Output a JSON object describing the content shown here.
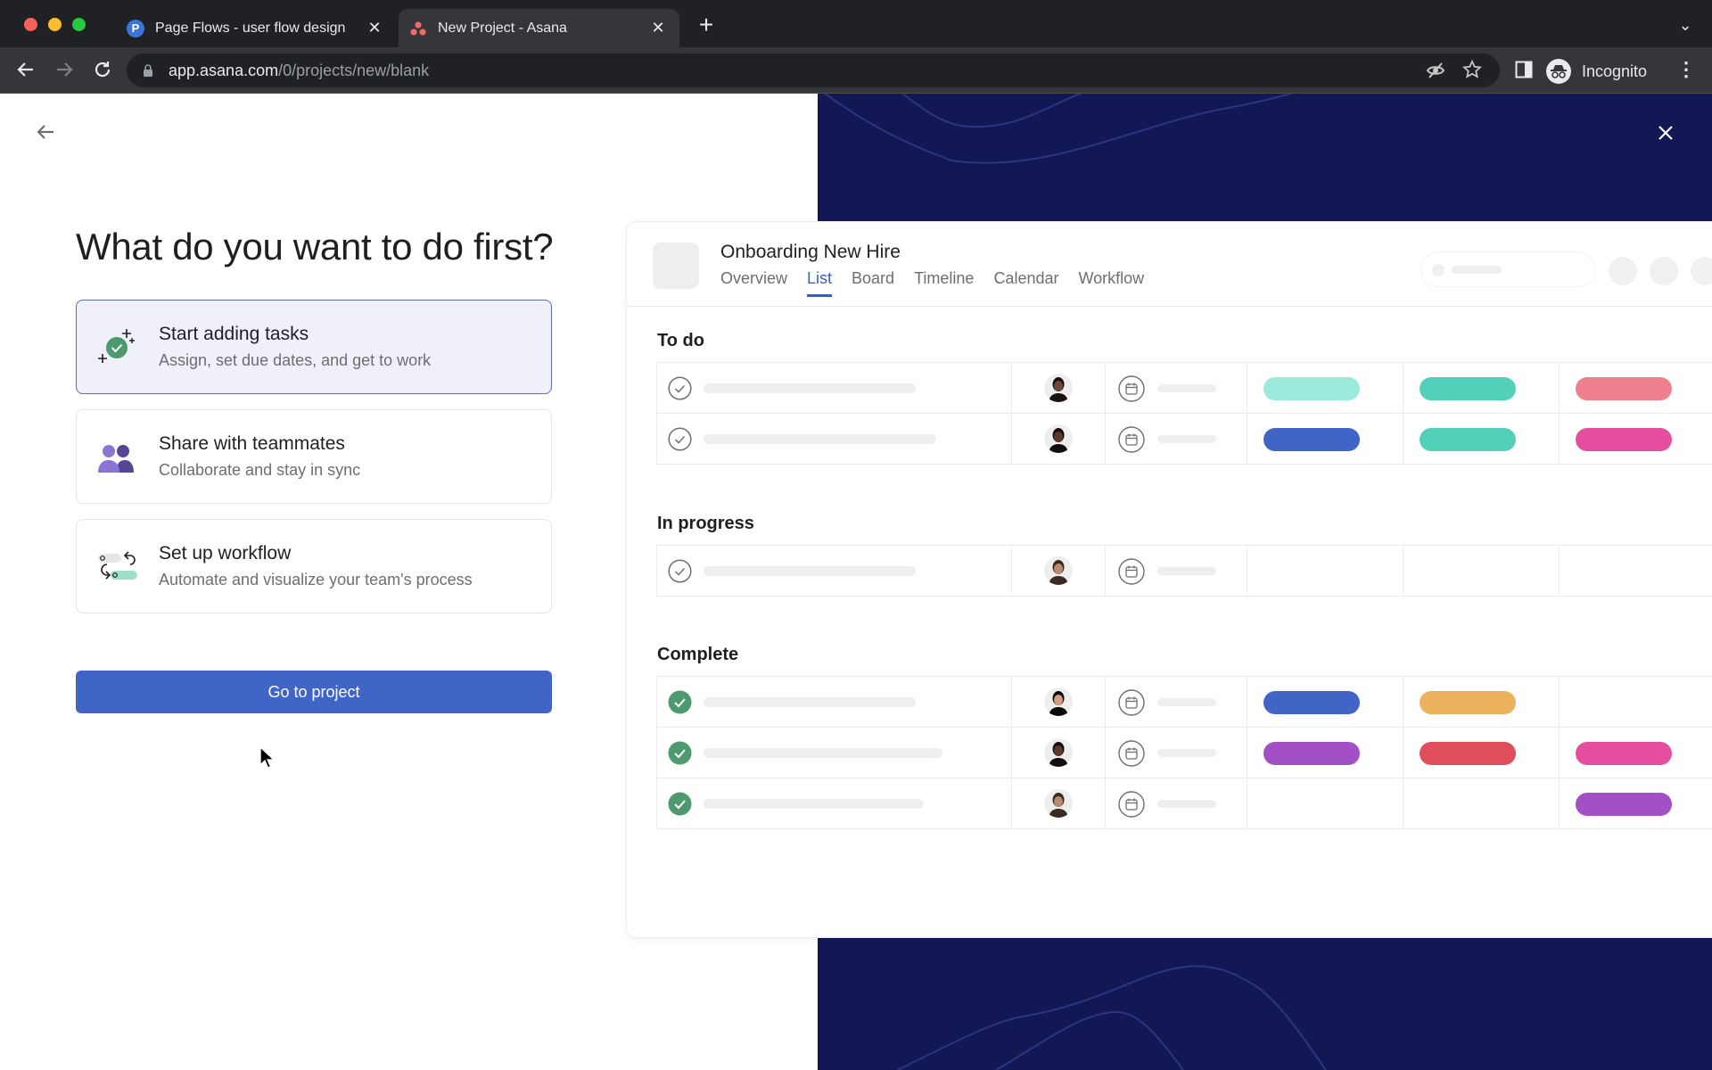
{
  "browser": {
    "tabs": [
      {
        "title": "Page Flows - user flow design",
        "favicon": "P",
        "favicon_color": "#3b73d6",
        "active": false
      },
      {
        "title": "New Project - Asana",
        "favicon": "asana-logo",
        "favicon_color": "#f06a6a",
        "active": true
      }
    ],
    "url_host": "app.asana.com",
    "url_path": "/0/projects/new/blank",
    "profile_label": "Incognito"
  },
  "page": {
    "heading": "What do you want to do first?",
    "options": [
      {
        "title": "Start adding tasks",
        "description": "Assign, set due dates, and get to work",
        "icon": "sparkle-check-icon",
        "selected": true
      },
      {
        "title": "Share with teammates",
        "description": "Collaborate and stay in sync",
        "icon": "people-icon",
        "selected": false
      },
      {
        "title": "Set up workflow",
        "description": "Automate and visualize your team's process",
        "icon": "workflow-icon",
        "selected": false
      }
    ],
    "primary_button": "Go to project",
    "accent_color": "#4065c6",
    "panel_color": "#131754"
  },
  "preview": {
    "project_title": "Onboarding New Hire",
    "tabs": [
      {
        "label": "Overview",
        "active": false
      },
      {
        "label": "List",
        "active": true
      },
      {
        "label": "Board",
        "active": false
      },
      {
        "label": "Timeline",
        "active": false
      },
      {
        "label": "Calendar",
        "active": false
      },
      {
        "label": "Workflow",
        "active": false
      }
    ],
    "sections": [
      {
        "title": "To do",
        "rows": [
          {
            "complete": false,
            "avatar": "man-1",
            "tags": [
              "#9beadb",
              "#52d0b9",
              "#f0808d"
            ]
          },
          {
            "complete": false,
            "avatar": "woman-1",
            "tags": [
              "#4065c6",
              "#52d0b9",
              "#e64ea0"
            ]
          }
        ]
      },
      {
        "title": "In progress",
        "rows": [
          {
            "complete": false,
            "avatar": "man-2",
            "tags": [
              null,
              null,
              null
            ]
          }
        ]
      },
      {
        "title": "Complete",
        "rows": [
          {
            "complete": true,
            "avatar": "woman-2",
            "tags": [
              "#4065c6",
              "#ecb25e",
              null
            ]
          },
          {
            "complete": true,
            "avatar": "woman-1",
            "tags": [
              "#a34fc6",
              "#e04e5c",
              "#e64ea0"
            ]
          },
          {
            "complete": true,
            "avatar": "man-2",
            "tags": [
              null,
              null,
              "#a34fc6"
            ]
          }
        ]
      }
    ]
  }
}
